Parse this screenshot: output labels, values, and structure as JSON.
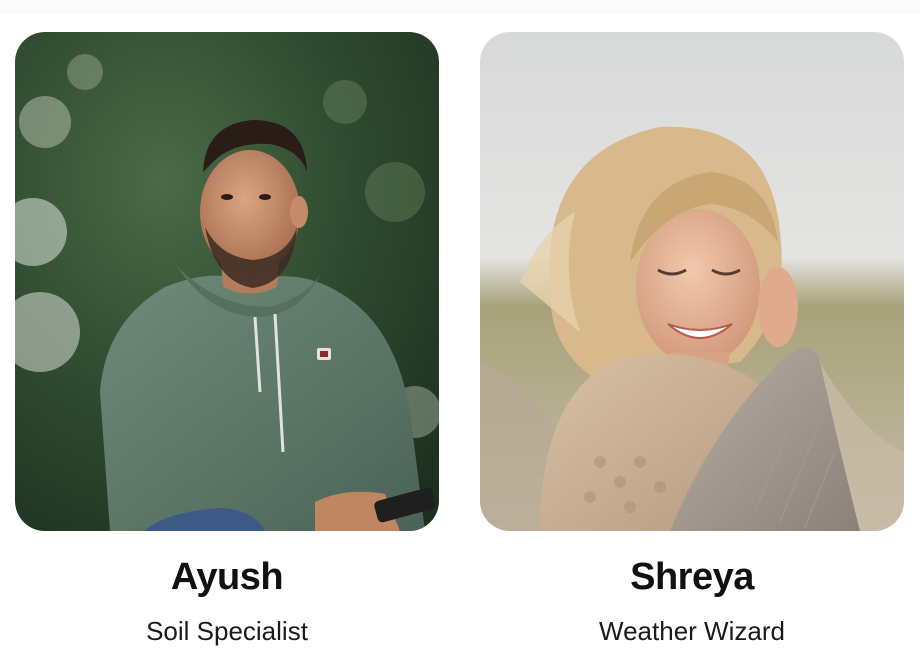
{
  "team": [
    {
      "name": "Ayush",
      "role": "Soil Specialist"
    },
    {
      "name": "Shreya",
      "role": "Weather Wizard"
    }
  ],
  "colors": {
    "name_text": "#111111",
    "role_text": "#1a1a1a",
    "hoodie_green": "#5f7a6b",
    "sweater_beige": "#c9ad93",
    "background": "#ffffff"
  }
}
